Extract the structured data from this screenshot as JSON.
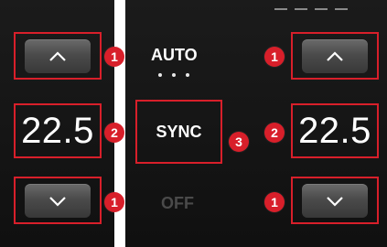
{
  "left": {
    "temperature": "22.5",
    "up_badge": "1",
    "temp_badge": "2",
    "down_badge": "1"
  },
  "center": {
    "auto_label": "AUTO",
    "sync_label": "SYNC",
    "sync_badge": "3",
    "off_label": "OFF"
  },
  "right": {
    "temperature": "22.5",
    "up_badge": "1",
    "temp_badge": "2",
    "down_badge": "1"
  },
  "colors": {
    "callout": "#d81f2a",
    "panel_bg": "#151515",
    "text": "#ffffff",
    "off_text": "#4a4a4a"
  },
  "icons": {
    "up": "chevron-up-icon",
    "down": "chevron-down-icon",
    "seat": "seat-heater-icon"
  }
}
